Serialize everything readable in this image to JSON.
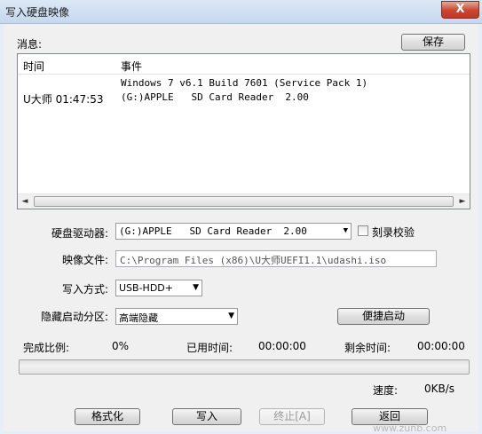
{
  "window": {
    "title": "写入硬盘映像",
    "close_label": "X"
  },
  "messages": {
    "label": "消息:",
    "save_label": "保存",
    "columns": {
      "time": "时间",
      "event": "事件"
    },
    "rows": [
      {
        "time": "",
        "event": "Windows 7 v6.1 Build 7601 (Service Pack 1)"
      },
      {
        "time": "U大师 01:47:53",
        "event": "(G:)APPLE   SD Card Reader  2.00"
      }
    ],
    "scroll_left": "◄",
    "scroll_right": "►"
  },
  "form": {
    "drive_label": "硬盘驱动器:",
    "drive_value": "(G:)APPLE   SD Card Reader  2.00",
    "verify_label": "刻录校验",
    "verify_checked": false,
    "image_label": "映像文件:",
    "image_value": "C:\\Program Files (x86)\\U大师UEFI1.1\\udashi.iso",
    "write_method_label": "写入方式:",
    "write_method_value": "USB-HDD+",
    "hidden_partition_label": "隐藏启动分区:",
    "hidden_partition_value": "高端隐藏",
    "quick_boot_label": "便捷启动"
  },
  "status": {
    "percent_label": "完成比例:",
    "percent_value": "0%",
    "elapsed_label": "已用时间:",
    "elapsed_value": "00:00:00",
    "remaining_label": "剩余时间:",
    "remaining_value": "00:00:00",
    "progress": 0,
    "speed_label": "速度:",
    "speed_value": "0KB/s"
  },
  "buttons": {
    "format": "格式化",
    "write": "写入",
    "stop": "终止[A]",
    "back": "返回"
  },
  "watermark": "www.zunb.com",
  "colors": {
    "progress_fill": "#3cb34a",
    "close_button": "#c9452f"
  }
}
